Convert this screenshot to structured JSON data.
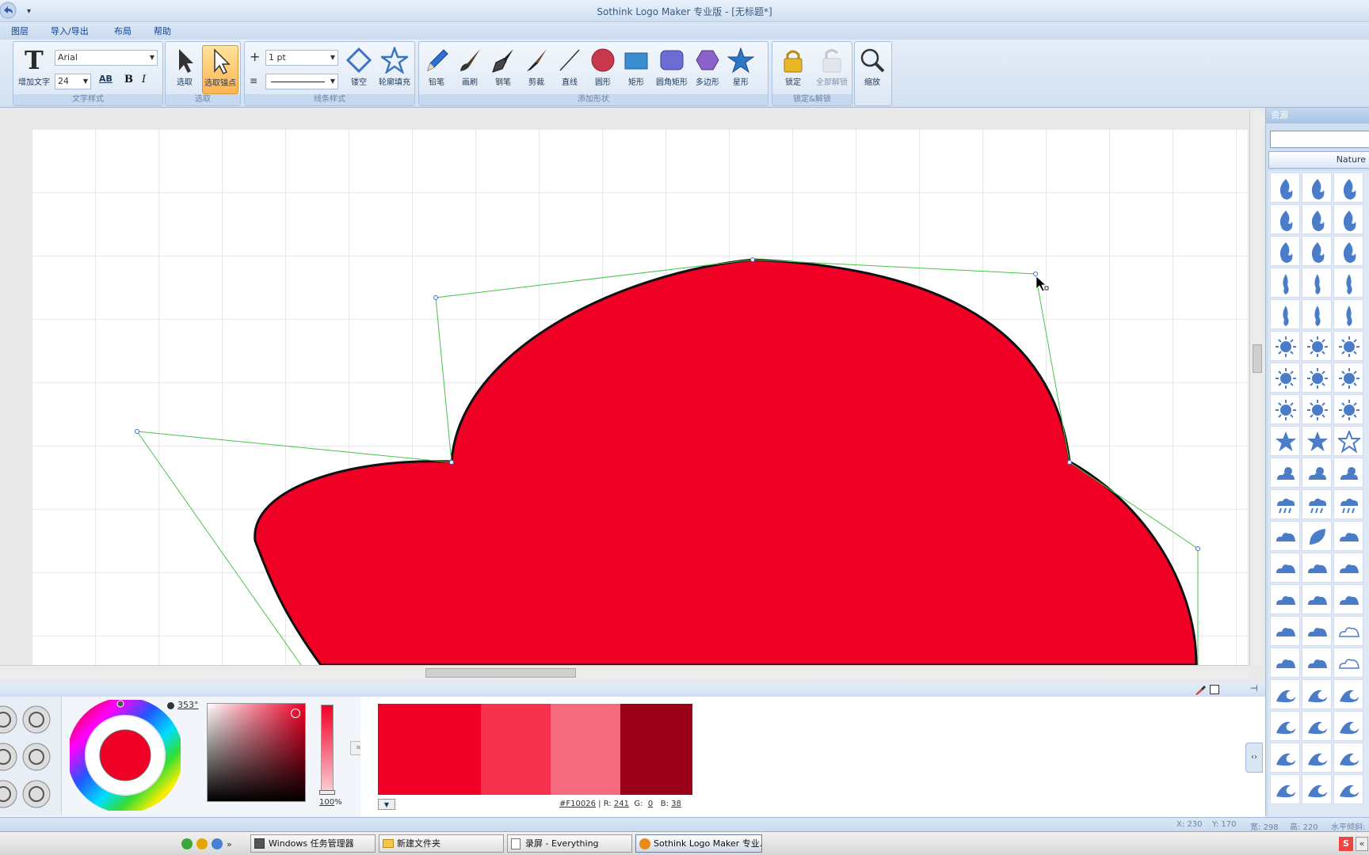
{
  "window": {
    "title": "Sothink Logo Maker 专业版 - [无标题*]"
  },
  "menu": {
    "items": [
      "图层",
      "导入/导出",
      "布局",
      "帮助"
    ]
  },
  "ribbon": {
    "text_group": {
      "label": "文字样式",
      "add_text": "增加文字",
      "font_name": "Arial",
      "font_size": "24",
      "bold": "B",
      "italic": "I",
      "spacing": "AB"
    },
    "select_group": {
      "label": "选取",
      "select": "选取",
      "select_anchor": "选取锚点"
    },
    "line_group": {
      "label": "线条样式",
      "width": "1 pt",
      "outline": "镂空",
      "outline_fill": "轮廓填充"
    },
    "shape_group": {
      "label": "添加形状",
      "tools": [
        "铅笔",
        "画刷",
        "钢笔",
        "剪裁",
        "直线",
        "圆形",
        "矩形",
        "圆角矩形",
        "多边形",
        "星形"
      ]
    },
    "lock_group": {
      "label": "锁定&解锁",
      "lock": "锁定",
      "unlock_all": "全部解锁"
    },
    "zoom_group": {
      "zoom": "缩放"
    }
  },
  "resources": {
    "title": "资源",
    "search_value": "",
    "category": "Nature",
    "icons": [
      "fire-icon",
      "fire-icon",
      "fire-icon",
      "fire-icon",
      "fire-icon",
      "fire-icon",
      "fire-icon",
      "fire-icon",
      "fire-icon",
      "flame-icon",
      "flame-icon",
      "flame-icon",
      "flame-icon",
      "flame-icon",
      "flame-icon",
      "sun-icon",
      "sun-icon",
      "sun-icon",
      "sun-icon",
      "sun-icon",
      "sun-icon",
      "sun-icon",
      "sun-icon",
      "sun-icon",
      "star-icon",
      "star-icon",
      "star-outline-icon",
      "weather-icon",
      "weather-icon",
      "weather-icon",
      "rain-cloud-icon",
      "rain-cloud-icon",
      "rain-cloud-icon",
      "cloud-icon",
      "leaf-icon",
      "cloud-icon",
      "cloud-icon",
      "cloud-icon",
      "cloud-icon",
      "cloud-icon",
      "cloud-icon",
      "cloud-icon",
      "cloud-icon",
      "cloud-icon",
      "cloud-outline-icon",
      "cloud-icon",
      "cloud-icon",
      "cloud-outline-icon",
      "wave-icon",
      "wave-icon",
      "wave-icon",
      "wave-icon",
      "wave-icon",
      "wave-icon",
      "wave-icon",
      "wave-icon",
      "wave-icon",
      "wave-icon",
      "wave-icon",
      "wave-icon"
    ]
  },
  "color": {
    "hue": "353°",
    "opacity": "100",
    "opacity_unit": "%",
    "hex": "#F10026",
    "r_label": "R:",
    "r": "241",
    "g_label": "G:",
    "g": "0",
    "b_label": "B:",
    "b": "38",
    "fill": "#F10026",
    "swatches": [
      "#F10026",
      "#F5324E",
      "#F66A7E",
      "#9A0018"
    ]
  },
  "status": {
    "x_label": "X:",
    "x": "230",
    "y_label": "Y:",
    "y": "170",
    "w_label": "宽:",
    "w": "298",
    "h_label": "高:",
    "h": "220",
    "extra": "水平倾斜:"
  },
  "taskbar": {
    "tasks": [
      "Windows 任务管理器",
      "新建文件夹",
      "录屏 - Everything",
      "Sothink Logo Maker 专业..."
    ]
  }
}
